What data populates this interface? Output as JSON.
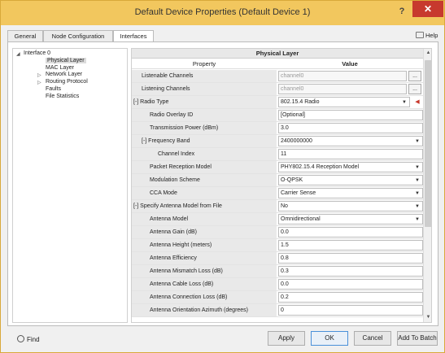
{
  "window": {
    "title": "Default Device Properties (Default Device 1)",
    "help_glyph": "?",
    "close_glyph": "✕"
  },
  "tabs": [
    {
      "label": "General"
    },
    {
      "label": "Node Configuration"
    },
    {
      "label": "Interfaces",
      "active": true
    }
  ],
  "help_label": "Help",
  "tree": {
    "root": "Interface 0",
    "items": [
      "Physical Layer",
      "MAC Layer",
      "Network Layer",
      "Routing Protocol",
      "Faults",
      "File Statistics"
    ],
    "selected": "Physical Layer"
  },
  "grid": {
    "section_title": "Physical Layer",
    "col_property": "Property",
    "col_value": "Value",
    "rows": [
      {
        "label": "Listenable Channels",
        "value": "channel0",
        "kind": "text-disabled",
        "dots": true
      },
      {
        "label": "Listening Channels",
        "value": "channel0",
        "kind": "text-disabled",
        "dots": true
      },
      {
        "label": "[-] Radio Type",
        "value": "802.15.4 Radio",
        "kind": "dropdown",
        "red": true
      },
      {
        "label": "Radio Overlay ID",
        "value": "[Optional]",
        "kind": "text"
      },
      {
        "label": "Transmission Power (dBm)",
        "value": "3.0",
        "kind": "text"
      },
      {
        "label": "[-] Frequency Band",
        "value": "2400000000",
        "kind": "dropdown"
      },
      {
        "label": "Channel Index",
        "value": "11",
        "kind": "text"
      },
      {
        "label": "Packet Reception Model",
        "value": "PHY802.15.4 Reception Model",
        "kind": "dropdown"
      },
      {
        "label": "Modulation Scheme",
        "value": "O-QPSK",
        "kind": "dropdown"
      },
      {
        "label": "CCA Mode",
        "value": "Carrier Sense",
        "kind": "dropdown"
      },
      {
        "label": "[-] Specify Antenna Model from File",
        "value": "No",
        "kind": "dropdown"
      },
      {
        "label": "Antenna Model",
        "value": "Omnidirectional",
        "kind": "dropdown"
      },
      {
        "label": "Antenna Gain (dB)",
        "value": "0.0",
        "kind": "text"
      },
      {
        "label": "Antenna Height (meters)",
        "value": "1.5",
        "kind": "text"
      },
      {
        "label": "Antenna Efficiency",
        "value": "0.8",
        "kind": "text"
      },
      {
        "label": "Antenna Mismatch Loss (dB)",
        "value": "0.3",
        "kind": "text"
      },
      {
        "label": "Antenna Cable Loss (dB)",
        "value": "0.0",
        "kind": "text"
      },
      {
        "label": "Antenna Connection Loss (dB)",
        "value": "0.2",
        "kind": "text"
      },
      {
        "label": "Antenna Orientation Azimuth (degrees)",
        "value": "0",
        "kind": "text"
      }
    ],
    "dots_label": "...",
    "dropdown_glyph": "▼",
    "red_glyph": "◀"
  },
  "footer": {
    "find_label": "Find",
    "buttons": [
      "Apply",
      "OK",
      "Cancel",
      "Add To Batch"
    ]
  }
}
